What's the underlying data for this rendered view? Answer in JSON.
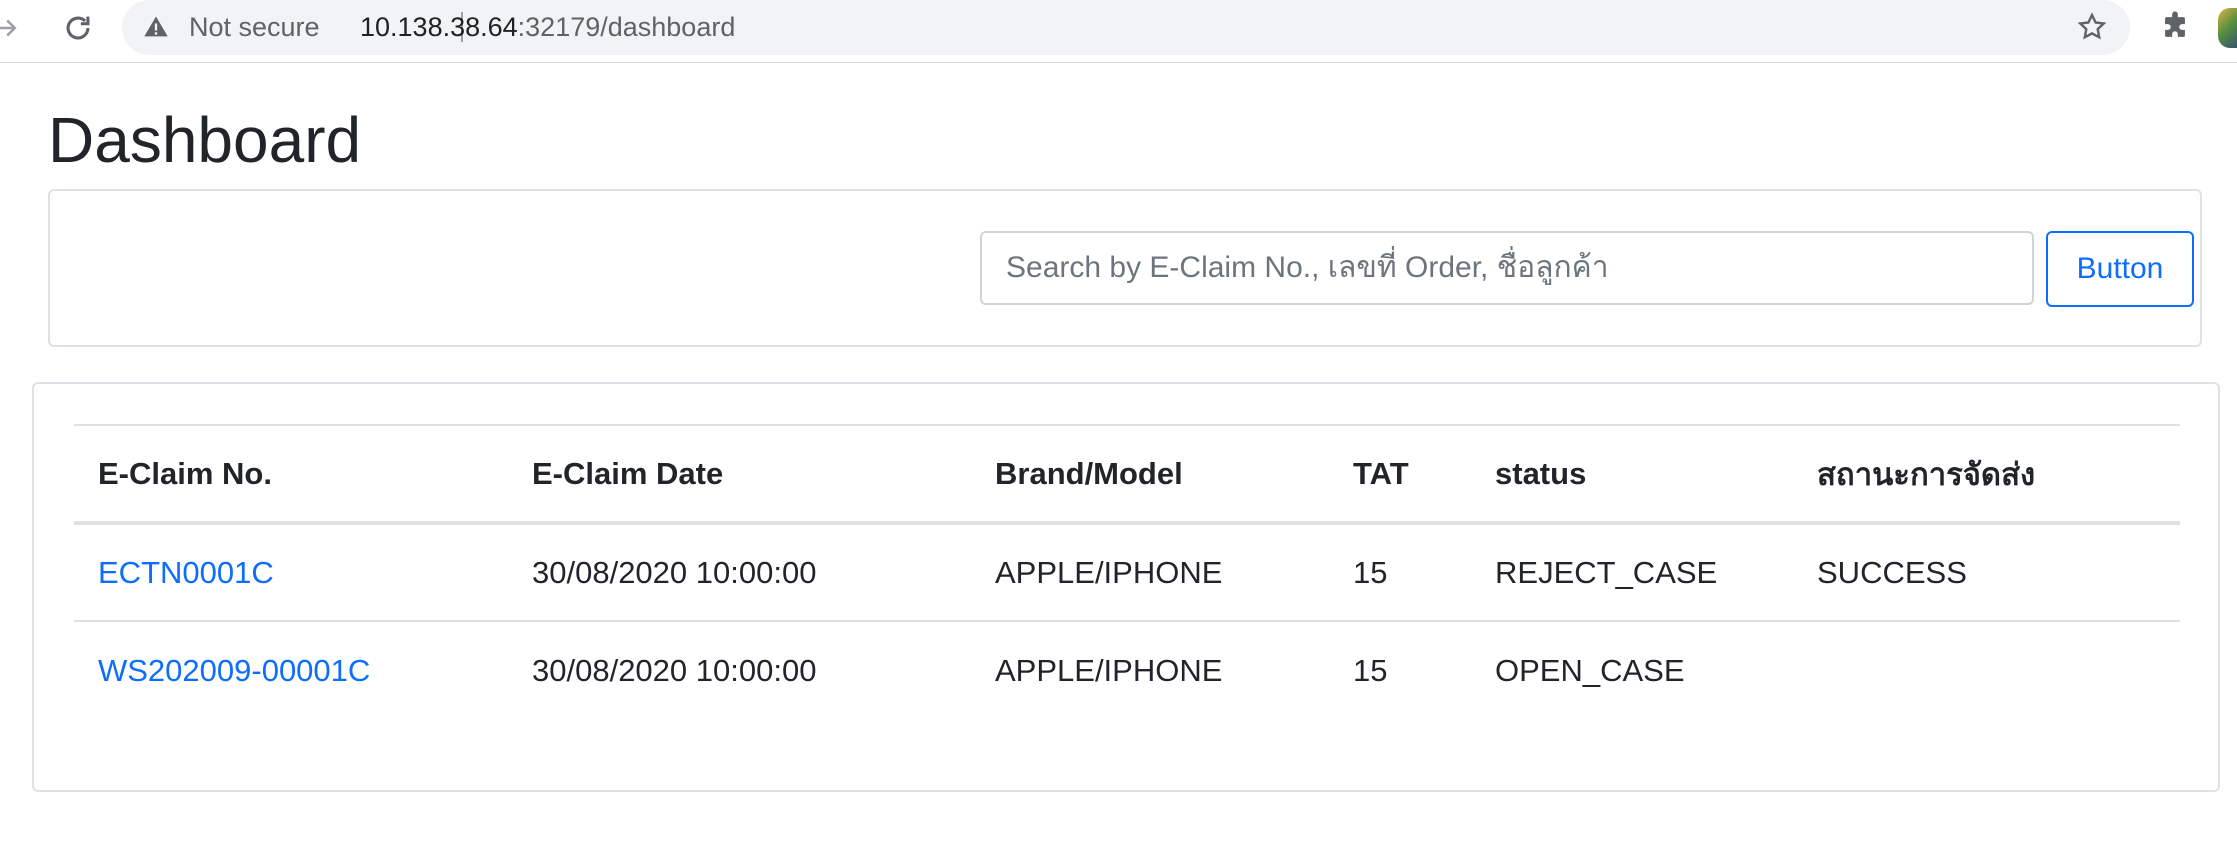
{
  "browser": {
    "security_label": "Not secure",
    "url_host": "10.138.38.64",
    "url_rest": ":32179/dashboard"
  },
  "page": {
    "title": "Dashboard"
  },
  "search": {
    "placeholder": "Search by E-Claim No., เลขที่ Order, ชื่อลูกค้า",
    "button_label": "Button"
  },
  "table": {
    "headers": [
      "E-Claim No.",
      "E-Claim Date",
      "Brand/Model",
      "TAT",
      "status",
      "สถานะการจัดส่ง"
    ],
    "rows": [
      {
        "claim_no": "ECTN0001C",
        "claim_date": "30/08/2020 10:00:00",
        "brand_model": "APPLE/IPHONE",
        "tat": "15",
        "status": "REJECT_CASE",
        "delivery_status": "SUCCESS"
      },
      {
        "claim_no": "WS202009-00001C",
        "claim_date": "30/08/2020 10:00:00",
        "brand_model": "APPLE/IPHONE",
        "tat": "15",
        "status": "OPEN_CASE",
        "delivery_status": ""
      }
    ]
  },
  "colors": {
    "link": "#0d6efd",
    "border": "#dee2e6",
    "text": "#212529"
  },
  "icons": [
    "forward-arrow-icon",
    "reload-icon",
    "warning-icon",
    "bookmark-star-icon",
    "extensions-puzzle-icon",
    "profile-avatar"
  ]
}
